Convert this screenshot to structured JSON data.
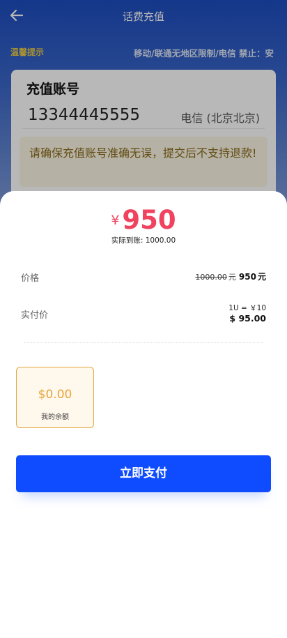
{
  "header": {
    "title": "话费充值",
    "back_icon": "arrow-left-icon"
  },
  "notice": {
    "label": "温馨提示",
    "text": "移动/联通无地区限制/电信 禁止：安"
  },
  "account": {
    "title": "充值账号",
    "phone": "13344445555",
    "carrier": "电信 (北京北京)",
    "warning": "请确保充值账号准确无误，提交后不支持退款!"
  },
  "sheet": {
    "currency_symbol": "¥",
    "amount": "950",
    "received_label": "实际到账:",
    "received_value": "1000.00",
    "price_label": "价格",
    "original_price": "1000.00",
    "price_unit": "元",
    "new_price": "950",
    "pay_label": "实付价",
    "rate": "1U = ￥10",
    "usd_amount": "$ 95.00",
    "balance_amount": "$0.00",
    "balance_label": "我的余额",
    "pay_button": "立即支付"
  },
  "colors": {
    "accent_red": "#f0435f",
    "button_blue": "#0f4cff",
    "balance_orange": "#e8a33a"
  }
}
